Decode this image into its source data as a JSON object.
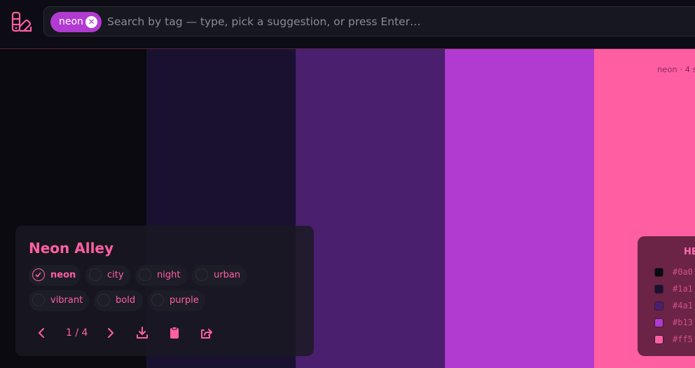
{
  "search": {
    "chip_label": "neon",
    "placeholder": "Search by tag — type, pick a suggestion, or press Enter…"
  },
  "palette": {
    "swatches": [
      "#0a0a10",
      "#1a1130",
      "#4a1f6e",
      "#b13ad0",
      "#ff5fa2"
    ],
    "corner_label": "neon · 4 s"
  },
  "card": {
    "title": "Neon Alley",
    "tags": [
      {
        "label": "neon",
        "selected": true
      },
      {
        "label": "city",
        "selected": false
      },
      {
        "label": "night",
        "selected": false
      },
      {
        "label": "urban",
        "selected": false
      },
      {
        "label": "vibrant",
        "selected": false
      },
      {
        "label": "bold",
        "selected": false
      },
      {
        "label": "purple",
        "selected": false
      }
    ],
    "counter": "1 / 4",
    "icons": [
      "chevron-left-icon",
      "chevron-right-icon",
      "download-icon",
      "clipboard-icon",
      "share-icon"
    ]
  },
  "hex": {
    "title": "HE",
    "values": [
      "#0a0",
      "#1a1",
      "#4a1",
      "#b13",
      "#ff5"
    ],
    "colors": [
      "#0a0a10",
      "#1a1130",
      "#4a1f6e",
      "#b13ad0",
      "#ff5fa2"
    ]
  },
  "colors": {
    "accent": "#ff5fa2",
    "chip": "#b13ad0"
  }
}
